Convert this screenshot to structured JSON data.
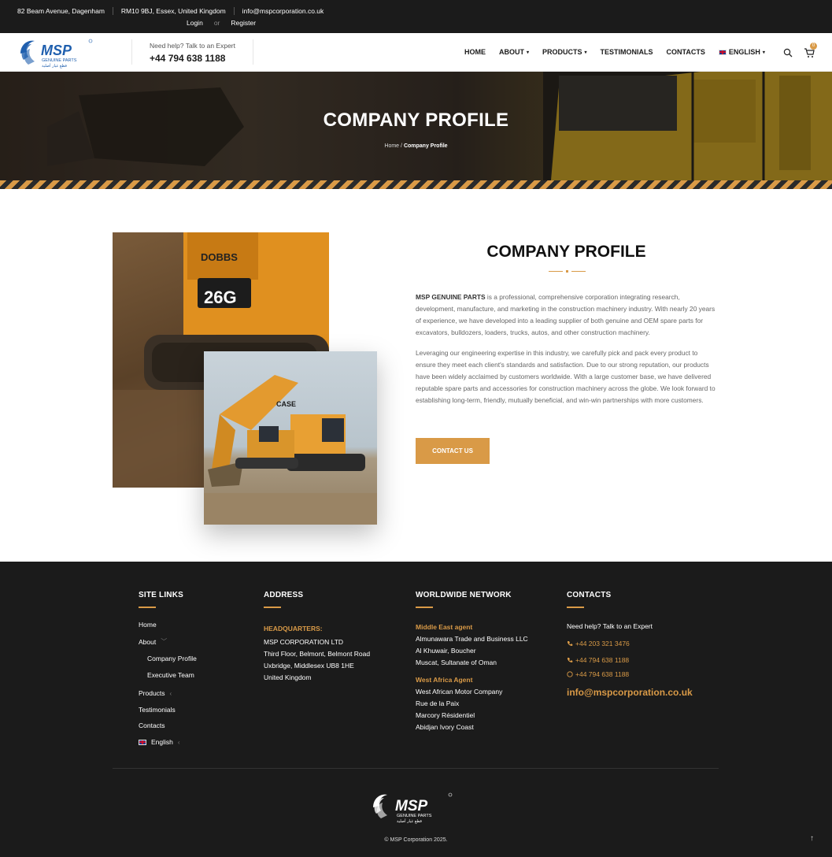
{
  "topbar": {
    "address1": "82 Beam Avenue, Dagenham",
    "address2": "RM10 9BJ, Essex, United Kingdom",
    "email": "info@mspcorporation.co.uk",
    "login": "Login",
    "or": "or",
    "register": "Register"
  },
  "header": {
    "help_text": "Need help? Talk to an Expert",
    "phone": "+44 794 638 1188",
    "nav": [
      {
        "label": "HOME",
        "caret": ""
      },
      {
        "label": "ABOUT",
        "caret": "▾"
      },
      {
        "label": "PRODUCTS",
        "caret": "▾"
      },
      {
        "label": "TESTIMONIALS",
        "caret": ""
      },
      {
        "label": "CONTACTS",
        "caret": ""
      },
      {
        "label": "ENGLISH",
        "caret": "▾"
      }
    ],
    "cart_count": "0",
    "icons": [
      "search-icon",
      "cart-icon"
    ]
  },
  "hero": {
    "title": "COMPANY PROFILE",
    "breadcrumb_home": "Home",
    "breadcrumb_sep": "/",
    "breadcrumb_current": "Company Profile"
  },
  "main": {
    "title": "COMPANY PROFILE",
    "p1_brand": "MSP GENUINE PARTS",
    "p1_rest": " is a professional, comprehensive corporation integrating research, development, manufacture, and marketing in the construction machinery industry. With nearly 20 years of experience, we have developed into a leading supplier of both genuine and OEM spare parts for excavators, bulldozers, loaders, trucks, autos, and other construction machinery.",
    "p2": "Leveraging our engineering expertise in this industry, we carefully pick and pack every product to ensure they meet each client's standards and satisfaction. Due to our strong reputation, our products have been widely acclaimed by customers worldwide. With a large customer base, we have delivered reputable spare parts and accessories for construction machinery across the globe. We look forward to establishing long-term, friendly, mutually beneficial, and win-win partnerships with more customers.",
    "cta": "CONTACT US",
    "image_text_brand": "DOBBS",
    "image_text_model": "26G",
    "image_text_case": "CASE"
  },
  "footer": {
    "site_links_title": "SITE LINKS",
    "site_links": [
      {
        "label": "Home",
        "chev": ""
      },
      {
        "label": "About",
        "chev": "﹀"
      },
      {
        "label": "Company Profile",
        "chev": ""
      },
      {
        "label": "Executive Team",
        "chev": ""
      },
      {
        "label": "Products",
        "chev": "‹"
      },
      {
        "label": "Testimonials",
        "chev": ""
      },
      {
        "label": "Contacts",
        "chev": ""
      },
      {
        "label": "English",
        "chev": "‹"
      }
    ],
    "address_title": "ADDRESS",
    "hq_label": "HEADQUARTERS:",
    "hq_lines": [
      "MSP CORPORATION LTD",
      "Third Floor, Belmont, Belmont Road",
      "Uxbridge, Middlesex UB8 1HE",
      "United Kingdom"
    ],
    "network_title": "WORLDWIDE NETWORK",
    "me_label": "Middle East agent",
    "me_lines": [
      "Almunawara Trade and Business LLC",
      "Al Khuwair, Boucher",
      "Muscat, Sultanate of Oman"
    ],
    "wa_label": "West Africa Agent",
    "wa_lines": [
      "West African Motor Company",
      "Rue de la Paix",
      "Marcory Résidentiel",
      "Abidjan Ivory Coast"
    ],
    "contacts_title": "CONTACTS",
    "contacts_help": "Need help? Talk to an Expert",
    "phone1": "+44 203 321 3476",
    "phone2": "+44 794 638 1188",
    "whatsapp": "+44 794 638 1188",
    "email": "info@mspcorporation.co.uk",
    "copyright": "© MSP Corporation 2025.",
    "to_top": "↑"
  },
  "brand": {
    "logo_text": "MSP",
    "logo_sub": "GENUINE PARTS",
    "logo_arabic": "قطع غيار أصلية",
    "accent": "#d99a47",
    "dark": "#1b1b1b",
    "brand_blue": "#1f5fae"
  }
}
